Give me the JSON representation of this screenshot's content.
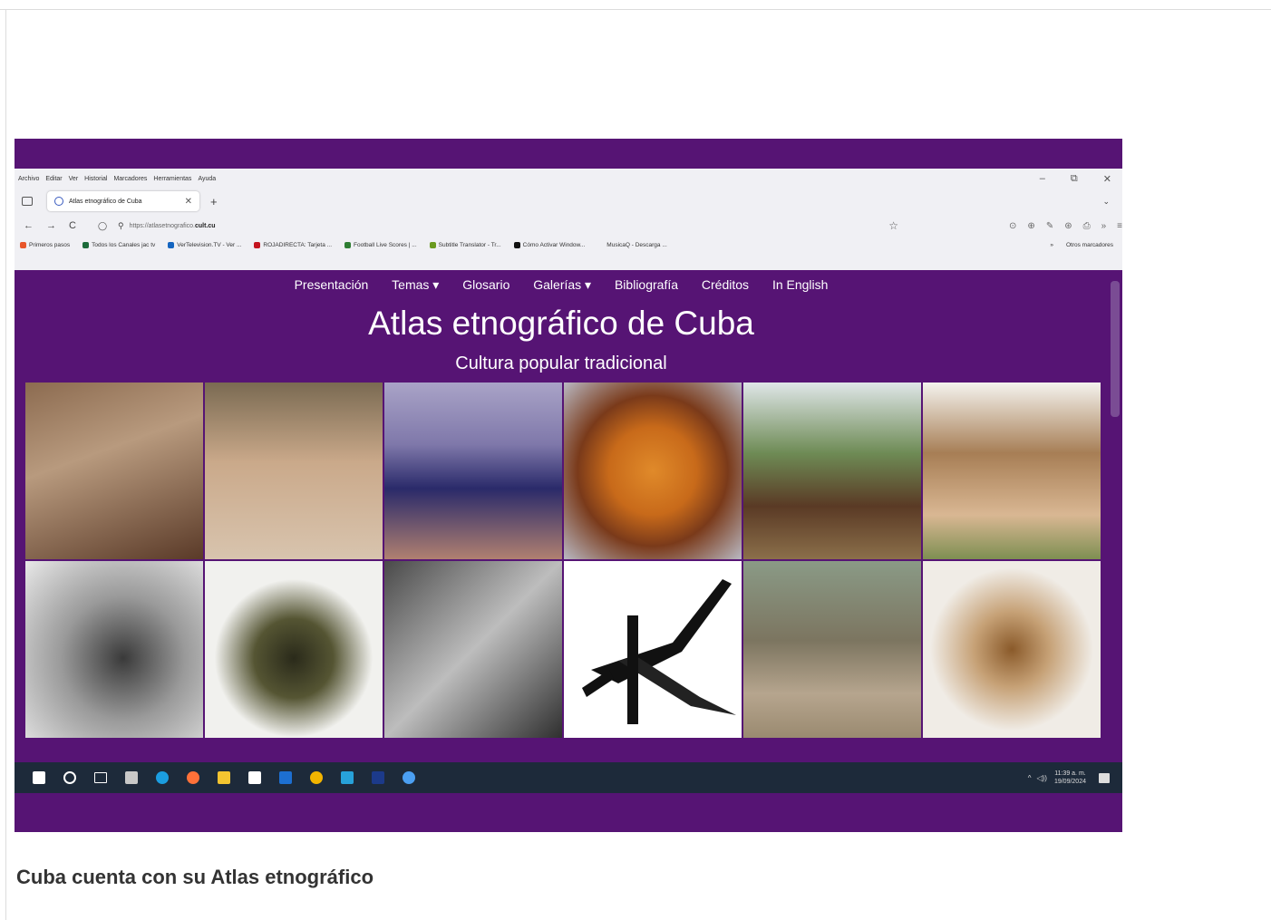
{
  "browser": {
    "menu": [
      "Archivo",
      "Editar",
      "Ver",
      "Historial",
      "Marcadores",
      "Herramientas",
      "Ayuda"
    ],
    "window_controls": [
      "–",
      "⧉",
      "✕"
    ],
    "tab": {
      "title": "Atlas etnográfico de Cuba",
      "close": "✕",
      "new_tab": "+"
    },
    "tab_list_icon": "⌄",
    "nav": {
      "back": "←",
      "forward": "→",
      "reload": "C"
    },
    "url": {
      "prefix": "https://atlasetnografico.",
      "domain": "cult.cu"
    },
    "bookmark_star": "☆",
    "extensions": [
      "⊙",
      "⊕",
      "✎",
      "⊛",
      "⎙",
      "»",
      "≡"
    ],
    "bookmarks": [
      {
        "label": "Primeros pasos",
        "color": "#e8562a"
      },
      {
        "label": "Todos los Canales jac tv",
        "color": "#1c6b3a"
      },
      {
        "label": "VerTelevision.TV - Ver ...",
        "color": "#1565c0"
      },
      {
        "label": "ROJADIRECTA: Tarjeta ...",
        "color": "#c4141f"
      },
      {
        "label": "Football Live Scores | ...",
        "color": "#2e7d32"
      },
      {
        "label": "Subtitle Translator - Tr...",
        "color": "#6a9a1f"
      },
      {
        "label": "Cómo Activar Window...",
        "color": "#111111"
      },
      {
        "label": "MusicaQ - Descarga ...",
        "color": "#f0f0f4"
      }
    ],
    "bookmarks_more": "»",
    "other_bookmarks": "Otros marcadores"
  },
  "site": {
    "nav": [
      "Presentación",
      "Temas ▾",
      "Glosario",
      "Galerías ▾",
      "Bibliografía",
      "Créditos",
      "In English"
    ],
    "title": "Atlas etnográfico de Cuba",
    "subtitle": "Cultura popular tradicional"
  },
  "taskbar": {
    "apps": [
      "windows-start",
      "search",
      "task-view",
      "calculator",
      "edge",
      "firefox",
      "file-explorer",
      "store",
      "mail",
      "chrome",
      "app",
      "photoshop",
      "recorder"
    ],
    "tray_chevron": "^",
    "volume": "◁))",
    "time": "11:39 a. m.",
    "date": "19/09/2024"
  },
  "caption": "Cuba cuenta con su Atlas etnográfico",
  "colors": {
    "accent": "#561474",
    "taskbar": "#1d2a3a"
  }
}
